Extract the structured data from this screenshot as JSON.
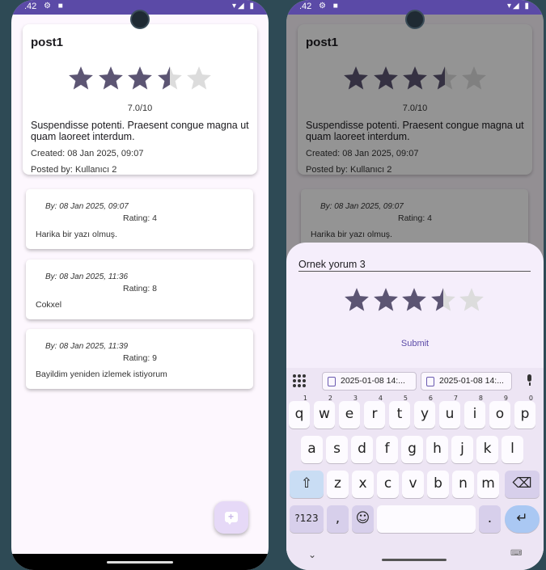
{
  "status": {
    "time": ".42",
    "left_icons": "⚙ ■",
    "right_icons": "▾◢ ▮"
  },
  "post": {
    "title": "post1",
    "rating": 3.5,
    "max_rating": 5,
    "rating_text": "7.0/10",
    "body": "Suspendisse potenti. Praesent congue magna ut quam laoreet interdum.",
    "created": "Created: 08 Jan 2025, 09:07",
    "posted_by": "Posted by: Kullanıcı 2"
  },
  "comments": [
    {
      "by": "By: 08 Jan 2025, 09:07",
      "rating": "Rating: 4",
      "text": "Harika bir yazı olmuş."
    },
    {
      "by": "By: 08 Jan 2025, 11:36",
      "rating": "Rating: 8",
      "text": "Cokxel"
    },
    {
      "by": "By: 08 Jan 2025, 11:39",
      "rating": "Rating: 9",
      "text": "Bayildim yeniden izlemek istiyorum"
    }
  ],
  "sheet": {
    "input_value": "Ornek yorum 3",
    "rating": 3.5,
    "submit_label": "Submit"
  },
  "keyboard": {
    "chips": [
      "2025-01-08 14:...",
      "2025-01-08 14:..."
    ],
    "row1": [
      "q",
      "w",
      "e",
      "r",
      "t",
      "y",
      "u",
      "i",
      "o",
      "p"
    ],
    "row1_hints": [
      "1",
      "2",
      "3",
      "4",
      "5",
      "6",
      "7",
      "8",
      "9",
      "0"
    ],
    "row2": [
      "a",
      "s",
      "d",
      "f",
      "g",
      "h",
      "j",
      "k",
      "l"
    ],
    "row3": [
      "z",
      "x",
      "c",
      "v",
      "b",
      "n",
      "m"
    ],
    "shift_label": "⇧",
    "backspace_label": "⌫",
    "symbols_label": "?123",
    "comma_label": ",",
    "emoji_label": "☺",
    "period_label": ".",
    "enter_label": "↵",
    "collapse_label": "⌄",
    "keyboard_icon_label": "⌨"
  },
  "colors": {
    "accent": "#5b4aa7",
    "star_filled": "#5c5573",
    "star_empty": "#dcdcdc",
    "background": "#2e4a55"
  }
}
